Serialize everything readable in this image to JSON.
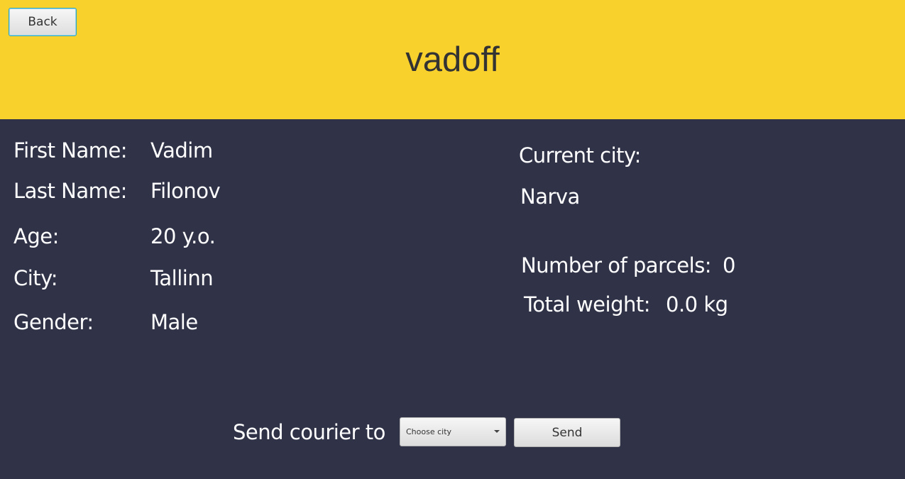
{
  "header": {
    "back_label": "Back",
    "username": "vadoff",
    "bg_color": "#f9d12d"
  },
  "profile": {
    "first_name_label": "First Name:",
    "first_name_value": "Vadim",
    "last_name_label": "Last Name:",
    "last_name_value": "Filonov",
    "age_label": "Age:",
    "age_value": "20 y.o.",
    "city_label": "City:",
    "city_value": "Tallinn",
    "gender_label": "Gender:",
    "gender_value": "Male"
  },
  "location": {
    "current_city_label": "Current city:",
    "current_city_value": "Narva"
  },
  "parcels": {
    "count_label": "Number of parcels:",
    "count_value": "0",
    "weight_label": "Total weight:",
    "weight_value": "0.0 kg"
  },
  "courier": {
    "prompt": "Send courier to",
    "select_placeholder": "Choose city",
    "send_label": "Send"
  },
  "colors": {
    "panel_bg": "#303348",
    "header_bg": "#f9d12d",
    "text": "#ffffff"
  }
}
